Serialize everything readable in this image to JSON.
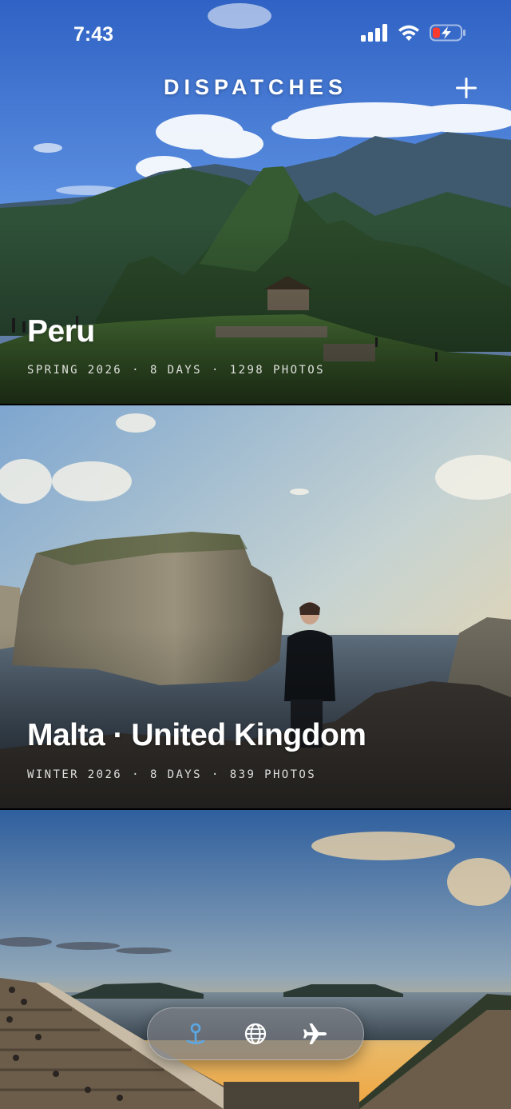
{
  "status_bar": {
    "time": "7:43",
    "icons": [
      "cellular-signal-icon",
      "wifi-icon",
      "battery-low-charging-icon"
    ],
    "battery_color": "#ff3b30"
  },
  "header": {
    "title": "DISPATCHES",
    "add_icon": "plus-icon"
  },
  "trips": [
    {
      "title": "Peru",
      "meta": [
        "SPRING 2026",
        "8 DAYS",
        "1298 PHOTOS"
      ],
      "separator": "·"
    },
    {
      "title": "Malta · United Kingdom",
      "meta": [
        "WINTER 2026",
        "8 DAYS",
        "839 PHOTOS"
      ],
      "separator": "·"
    }
  ],
  "tab_bar": {
    "tabs": [
      {
        "icon": "map-pin-icon",
        "active": true
      },
      {
        "icon": "globe-icon",
        "active": false
      },
      {
        "icon": "airplane-icon",
        "active": false
      }
    ],
    "active_color": "#5aa9e6",
    "inactive_color": "#ffffff"
  }
}
